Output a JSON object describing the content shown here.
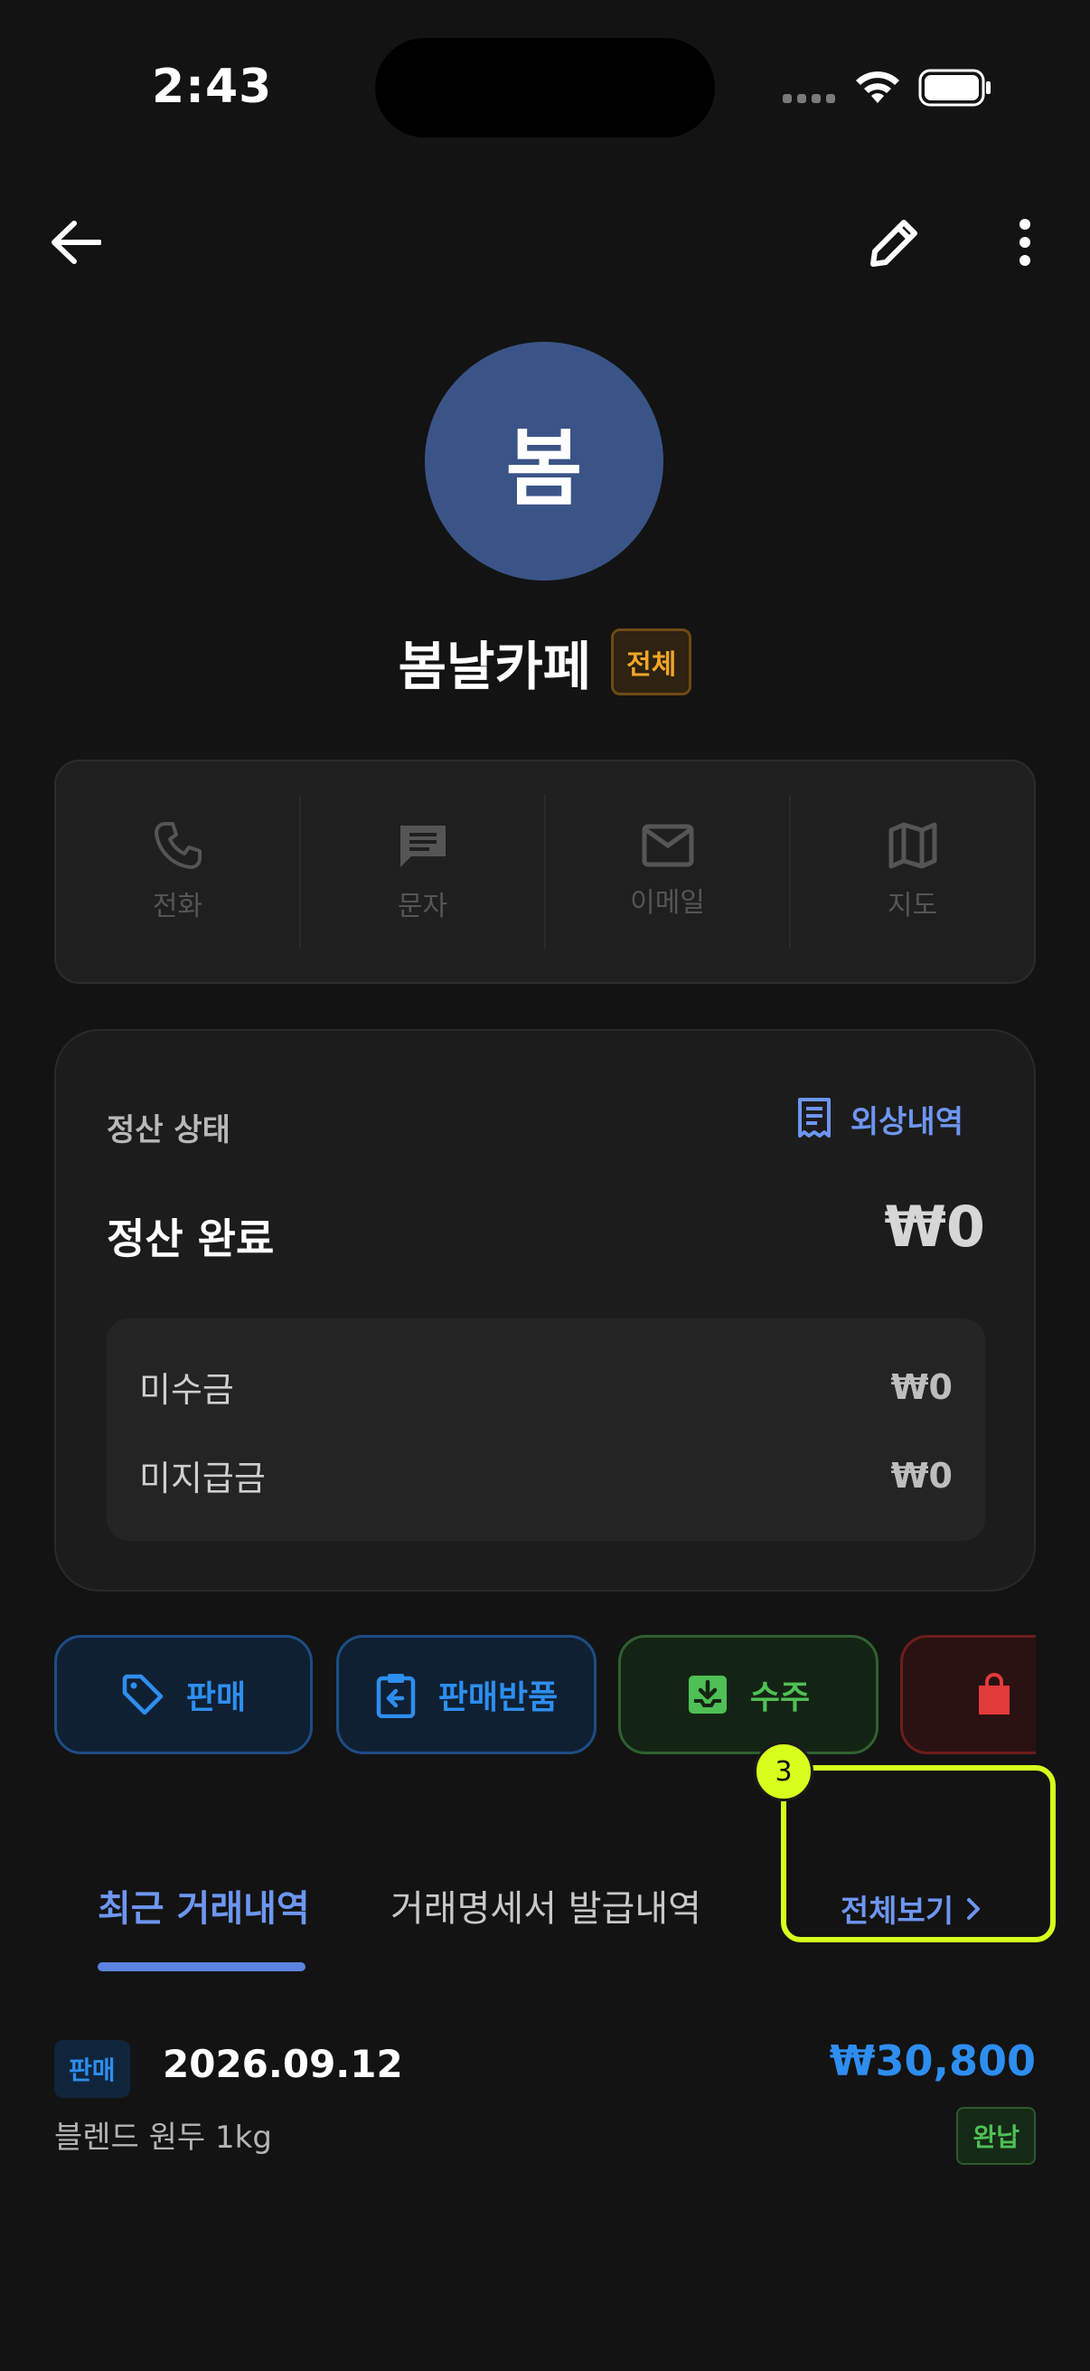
{
  "status_bar": {
    "time": "2:43"
  },
  "profile": {
    "initial": "봄",
    "name": "봄날카페",
    "group_badge": "전체"
  },
  "contact_actions": [
    {
      "label": "전화",
      "icon": "phone-icon"
    },
    {
      "label": "문자",
      "icon": "message-icon"
    },
    {
      "label": "이메일",
      "icon": "mail-icon"
    },
    {
      "label": "지도",
      "icon": "map-icon"
    }
  ],
  "settlement": {
    "label": "정산 상태",
    "outstanding_link": "외상내역",
    "status": "정산 완료",
    "amount": "₩0",
    "receivable_label": "미수금",
    "receivable_value": "₩0",
    "payable_label": "미지급금",
    "payable_value": "₩0"
  },
  "quick_actions": {
    "sale": "판매",
    "sale_return": "판매반품",
    "order": "수주"
  },
  "tabs": {
    "recent": "최근 거래내역",
    "invoices": "거래명세서 발급내역",
    "view_all": "전체보기"
  },
  "highlight": {
    "number": "3"
  },
  "transaction": {
    "type": "판매",
    "date": "2026.09.12",
    "amount": "₩30,800",
    "description": "블렌드 원두 1kg",
    "status": "완납"
  },
  "colors": {
    "accent": "#6d96f2",
    "sale": "#2d8ef0",
    "order": "#4fc055",
    "purchase": "#e33a3a",
    "highlight": "#d7ff1c"
  }
}
